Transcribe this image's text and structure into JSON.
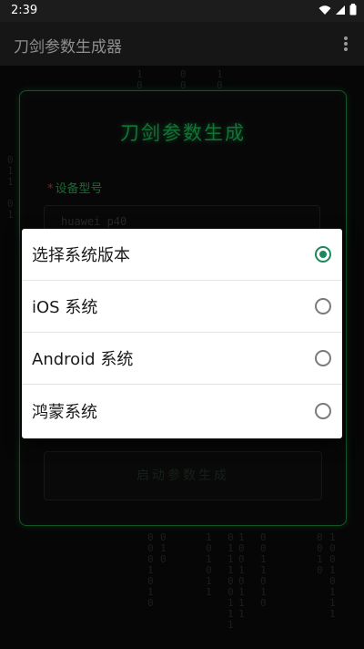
{
  "status_bar": {
    "time": "2:39"
  },
  "app_bar": {
    "title": "刀剑参数生成器"
  },
  "card": {
    "title": "刀剑参数生成",
    "field_label": "设备型号",
    "device_value": "huawei p40",
    "start_label": "启动参数生成"
  },
  "dialog": {
    "options": [
      {
        "label": "选择系统版本",
        "selected": true
      },
      {
        "label": "iOS 系统",
        "selected": false
      },
      {
        "label": "Android 系统",
        "selected": false
      },
      {
        "label": "鸿蒙系统",
        "selected": false
      }
    ]
  },
  "colors": {
    "accent": "#1fd160",
    "radio_selected": "#1b8a5a"
  },
  "icons": [
    "wifi-icon",
    "signal-icon",
    "battery-icon",
    "more-vert-icon"
  ]
}
